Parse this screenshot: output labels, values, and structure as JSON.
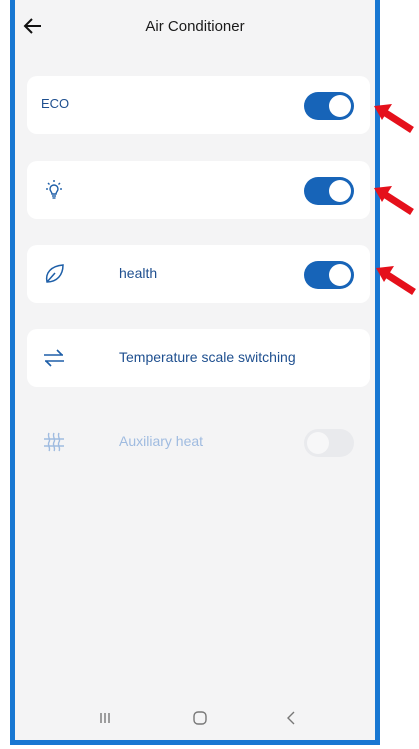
{
  "header": {
    "title": "Air Conditioner"
  },
  "settings": [
    {
      "label": "ECO",
      "icon": "eco-text",
      "toggle": "on"
    },
    {
      "label": "",
      "icon": "lightbulb-icon",
      "toggle": "on"
    },
    {
      "label": "health",
      "icon": "leaf-icon",
      "toggle": "on"
    },
    {
      "label": "Temperature scale switching",
      "icon": "swap-arrows-icon",
      "toggle": "none"
    },
    {
      "label": "Auxiliary heat",
      "icon": "heater-icon",
      "toggle": "off",
      "disabled": true
    }
  ],
  "navbar": {
    "buttons": [
      "recent-apps",
      "home",
      "back"
    ]
  },
  "colors": {
    "accent": "#1764b8",
    "frame": "#1877d2",
    "annotation_arrow": "#e5101b",
    "label": "#1e4f8f"
  }
}
